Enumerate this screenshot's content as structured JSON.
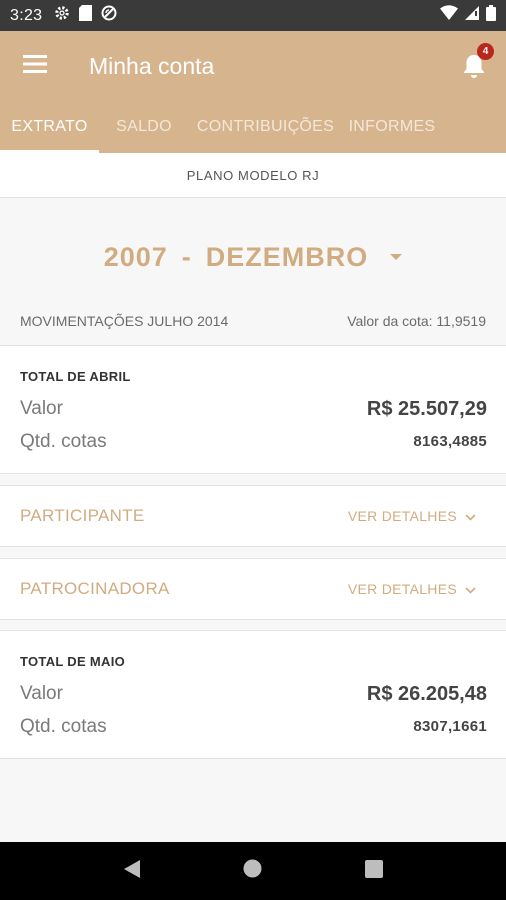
{
  "status_bar": {
    "time": "3:23",
    "left_icons": [
      "gear-icon",
      "sd-card-icon",
      "no-disturb-icon"
    ],
    "right_icons": [
      "wifi-icon",
      "signal-icon",
      "battery-icon"
    ]
  },
  "app_bar": {
    "title": "Minha conta",
    "notification_count": "4",
    "background_color": "#d6b48e"
  },
  "tabs": [
    {
      "label": "EXTRATO",
      "active": true
    },
    {
      "label": "SALDO",
      "active": false
    },
    {
      "label": "CONTRIBUIÇÕES",
      "active": false
    },
    {
      "label": "INFORMES",
      "active": false
    }
  ],
  "plan": {
    "name": "PLANO MODELO RJ"
  },
  "period": {
    "year": "2007",
    "separator": "-",
    "month": "DEZEMBRO"
  },
  "movements": {
    "title": "MOVIMENTAÇÕES JULHO 2014",
    "quota_value": "Valor da cota: 11,9519"
  },
  "total_april": {
    "title": "TOTAL DE ABRIL",
    "value_label": "Valor",
    "value": "R$ 25.507,29",
    "quota_label": "Qtd. cotas",
    "quota": "8163,4885"
  },
  "participante": {
    "label": "PARTICIPANTE",
    "link": "VER DETALHES"
  },
  "patrocinadora": {
    "label": "PATROCINADORA",
    "link": "VER DETALHES"
  },
  "total_may": {
    "title": "TOTAL DE MAIO",
    "value_label": "Valor",
    "value": "R$ 26.205,48",
    "quota_label": "Qtd. cotas",
    "quota": "8307,1661"
  },
  "colors": {
    "accent": "#d1ac80",
    "badge": "#b8261c"
  }
}
